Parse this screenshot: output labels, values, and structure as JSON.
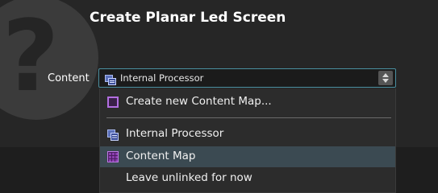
{
  "dialog": {
    "title": "Create Planar Led Screen",
    "help_glyph": "?"
  },
  "content_field": {
    "label": "Content",
    "selected_value": "Internal Processor",
    "selected_icon": "internal-processor-icon"
  },
  "dropdown": {
    "items": [
      {
        "label": "Create new Content Map...",
        "icon": "content-map-new-icon"
      },
      {
        "label": "Internal Processor",
        "icon": "internal-processor-icon"
      },
      {
        "label": "Content Map",
        "icon": "content-map-icon",
        "highlighted": true
      },
      {
        "label": "Leave unlinked for now",
        "icon": ""
      }
    ]
  },
  "colors": {
    "accent_border": "#4a8fa0",
    "highlight_row": "#3b4a52",
    "icon_purple": "#b26ee0"
  }
}
